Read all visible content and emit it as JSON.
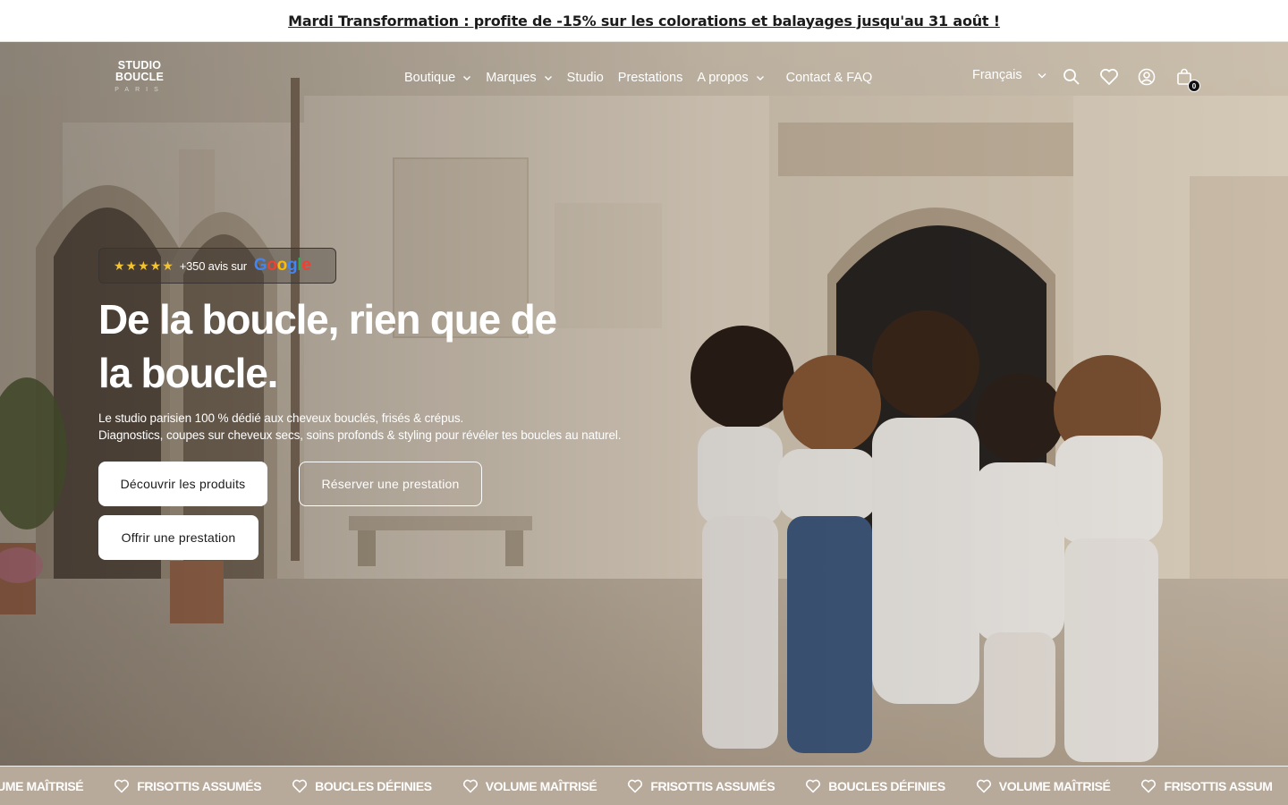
{
  "announcement": {
    "text": "Mardi Transformation : profite de -15% sur les colorations et balayages jusqu'au 31 août !"
  },
  "header": {
    "logo": {
      "line1": "STUDIO",
      "line2": "BOUCLE",
      "line3": "PARIS"
    },
    "nav": [
      {
        "label": "Boutique",
        "dropdown": true
      },
      {
        "label": "Marques",
        "dropdown": true
      },
      {
        "label": "Studio",
        "dropdown": false
      },
      {
        "label": "Prestations",
        "dropdown": false
      },
      {
        "label": "A propos",
        "dropdown": true
      },
      {
        "label": "Contact & FAQ",
        "dropdown": false
      }
    ],
    "language": "Français",
    "icons": [
      "search-icon",
      "heart-icon",
      "account-icon",
      "cart-icon"
    ],
    "cart_count": "0"
  },
  "hero": {
    "review": {
      "stars": "★★★★★",
      "text": "+350 avis sur",
      "brand_letters": [
        "G",
        "o",
        "o",
        "g",
        "l",
        "e"
      ]
    },
    "title_line1": "De la boucle, rien que de",
    "title_line2": "la boucle.",
    "subtitle_line1": "Le studio parisien 100 % dédié aux cheveux bouclés, frisés & crépus.",
    "subtitle_line2": "Diagnostics, coupes sur cheveux secs, soins profonds & styling pour révéler tes boucles au naturel.",
    "buttons": {
      "discover": "Découvrir les produits",
      "book": "Réserver une prestation",
      "gift": "Offrir une prestation"
    }
  },
  "marquee": {
    "items": [
      "LUME MAÎTRISÉ",
      "FRISOTTIS ASSUMÉS",
      "BOUCLES DÉFINIES",
      "VOLUME MAÎTRISÉ",
      "FRISOTTIS ASSUMÉS",
      "BOUCLES DÉFINIES",
      "VOLUME MAÎTRISÉ",
      "FRISOTTIS ASSUM"
    ]
  },
  "colors": {
    "marquee_bg": "#b8aa9b",
    "star": "#f4c430",
    "text_dark": "#1b1b1b"
  }
}
